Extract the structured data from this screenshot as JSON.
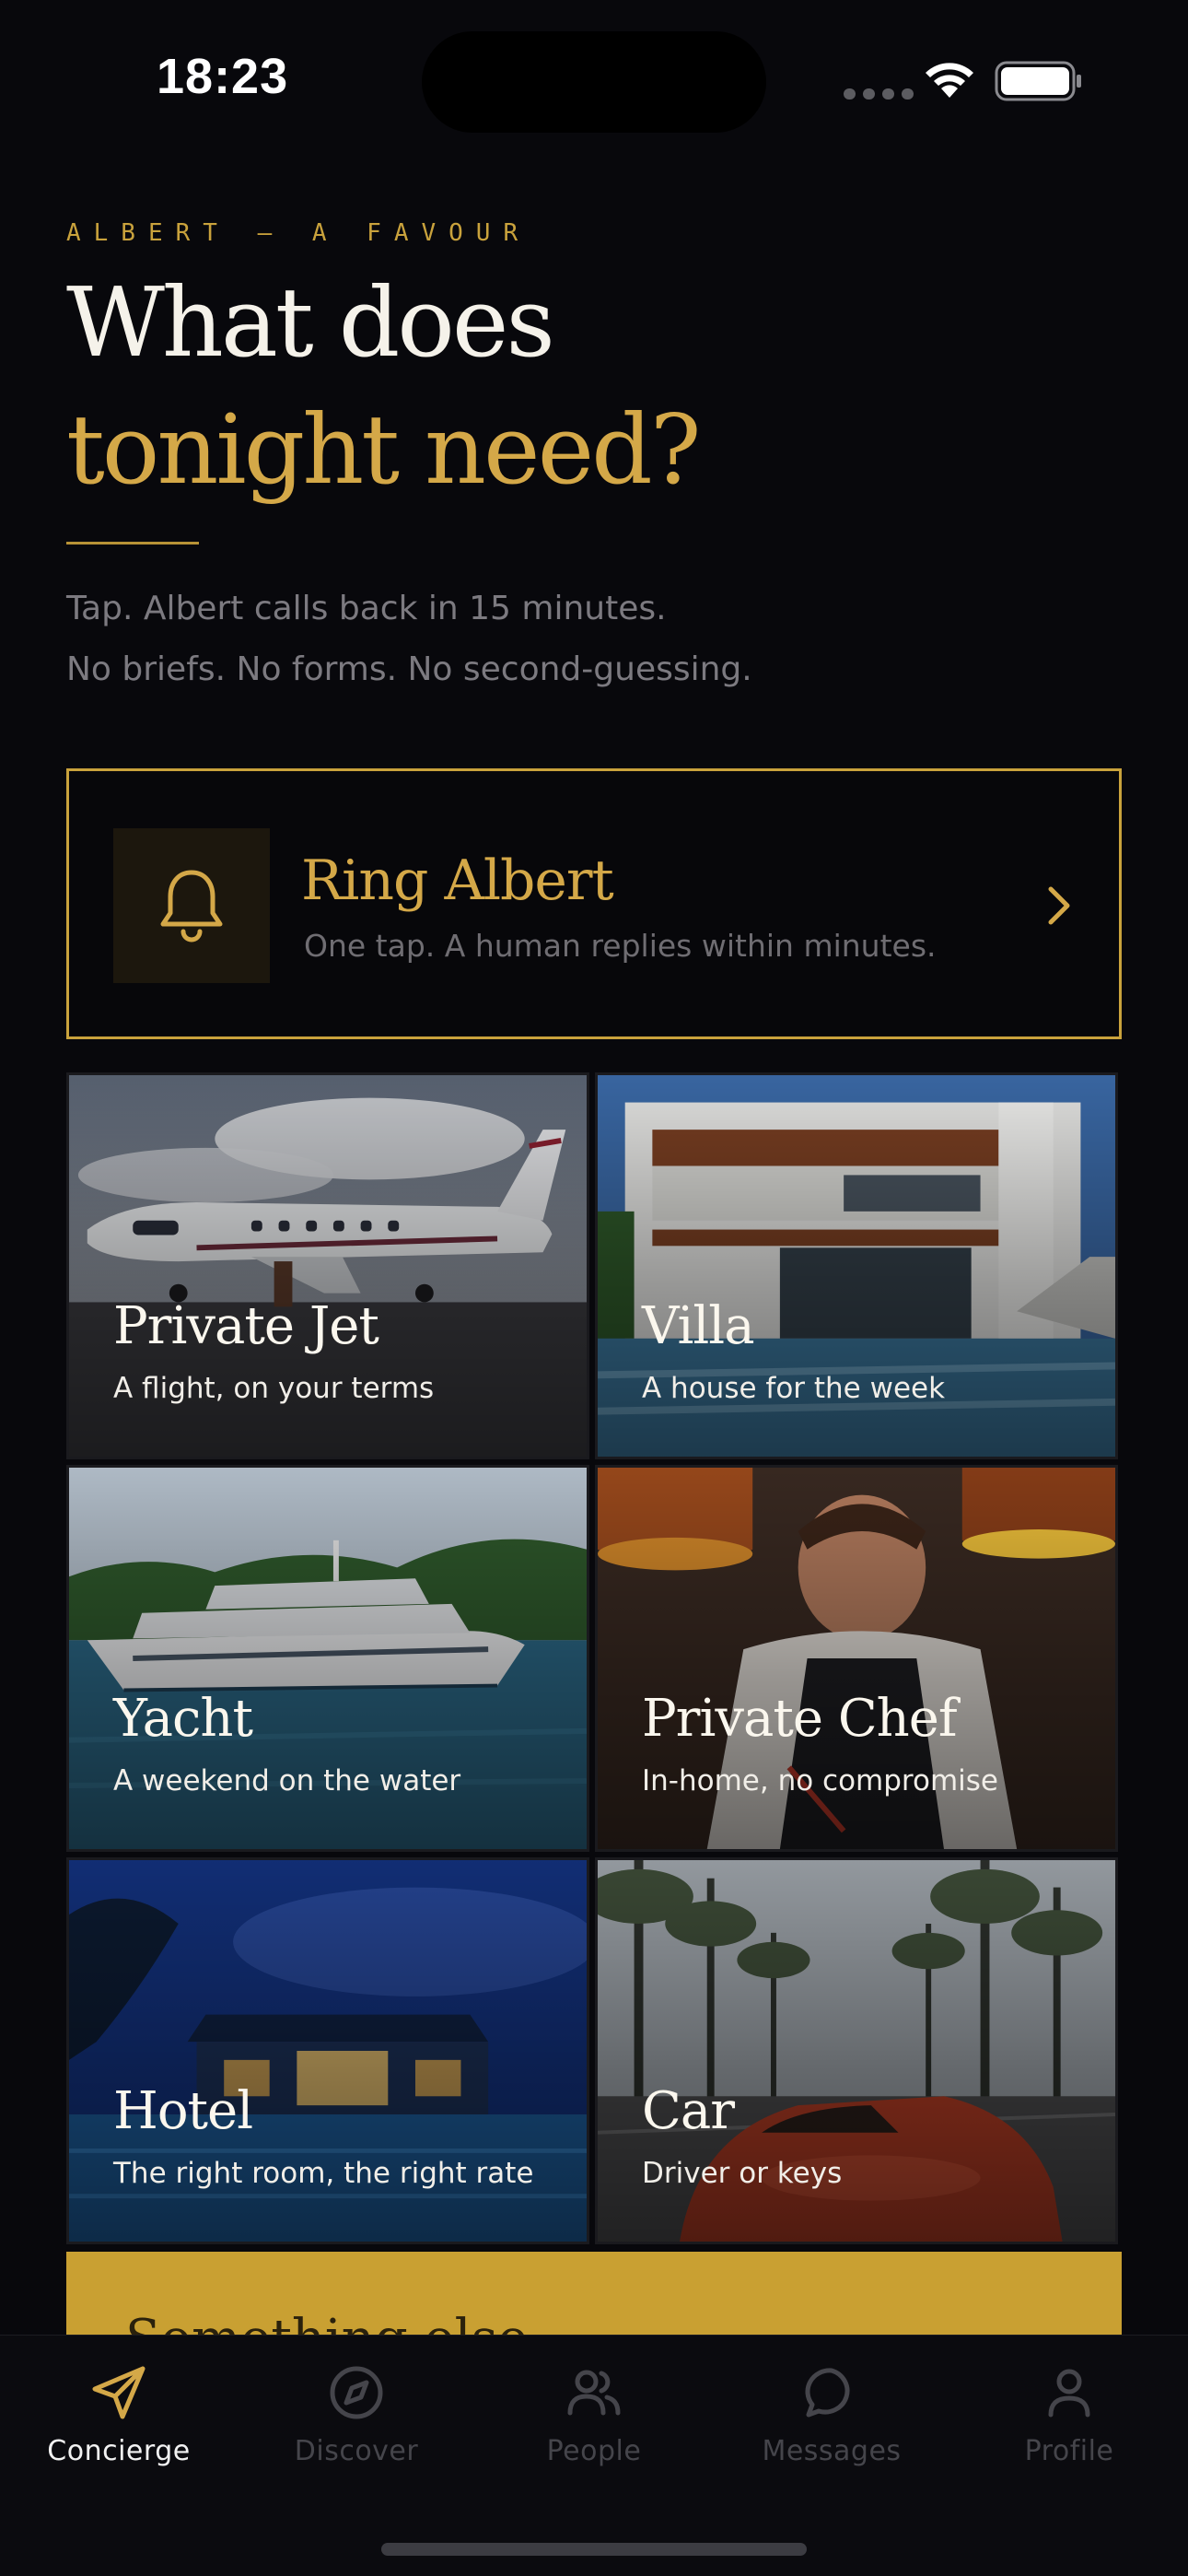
{
  "status_bar": {
    "time": "18:23"
  },
  "header": {
    "eyebrow": "ALBERT — A FAVOUR",
    "headline_line1": "What does",
    "headline_line2": "tonight need?",
    "subtext_line1": "Tap. Albert calls back in 15 minutes.",
    "subtext_line2": "No briefs. No forms. No second-guessing."
  },
  "ring_card": {
    "icon": "bell-icon",
    "title": "Ring Albert",
    "subtitle": "One tap. A human replies within minutes.",
    "chevron": "chevron-right-icon"
  },
  "services": [
    {
      "title": "Private Jet",
      "subtitle": "A flight, on your terms"
    },
    {
      "title": "Villa",
      "subtitle": "A house for the week"
    },
    {
      "title": "Yacht",
      "subtitle": "A weekend on the water"
    },
    {
      "title": "Private Chef",
      "subtitle": "In-home, no compromise"
    },
    {
      "title": "Hotel",
      "subtitle": "The right room, the right rate"
    },
    {
      "title": "Car",
      "subtitle": "Driver or keys"
    }
  ],
  "gold_strip": {
    "text": "Something else"
  },
  "tab_bar": {
    "tabs": [
      {
        "label": "Concierge",
        "icon": "send-icon",
        "active": true
      },
      {
        "label": "Discover",
        "icon": "compass-icon",
        "active": false
      },
      {
        "label": "People",
        "icon": "people-icon",
        "active": false
      },
      {
        "label": "Messages",
        "icon": "message-icon",
        "active": false
      },
      {
        "label": "Profile",
        "icon": "user-icon",
        "active": false
      }
    ]
  },
  "colors": {
    "background": "#08080c",
    "gold": "#c9a23c",
    "headline_gold": "#d4a848",
    "muted_text": "#7c7a80",
    "inactive_tab": "#45454b"
  }
}
